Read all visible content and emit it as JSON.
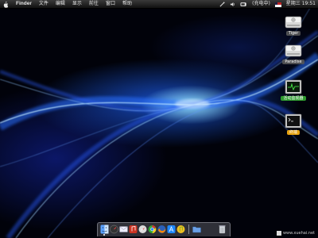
{
  "menubar": {
    "app": "Finder",
    "menus": [
      "文件",
      "编辑",
      "显示",
      "前往",
      "窗口",
      "帮助"
    ],
    "status": {
      "volume_icon": "speaker-icon",
      "battery_text": "(充电中)",
      "flag_icon": "us-flag-icon",
      "clock": "星期三 19:51"
    }
  },
  "desktop": {
    "icons": [
      {
        "label": "Tiger",
        "icon": "hard-drive-icon"
      },
      {
        "label": "Paradise",
        "icon": "hard-drive-icon"
      },
      {
        "label": "活动监视器",
        "icon": "activity-monitor-icon"
      },
      {
        "label": "终端",
        "icon": "terminal-icon"
      }
    ]
  },
  "dock": {
    "icons": [
      "finder-icon",
      "dashboard-icon",
      "mail-icon",
      "itunes-icon",
      "safari-icon",
      "chrome-icon",
      "firefox-icon",
      "app-store-icon",
      "itunes-music-icon",
      "folder-icon"
    ],
    "trash_icon": "trash-icon"
  },
  "watermark": {
    "text": "www.xuehai.net"
  },
  "colors": {
    "accent": "#1e6eff",
    "glow": "#9fe0ff"
  }
}
